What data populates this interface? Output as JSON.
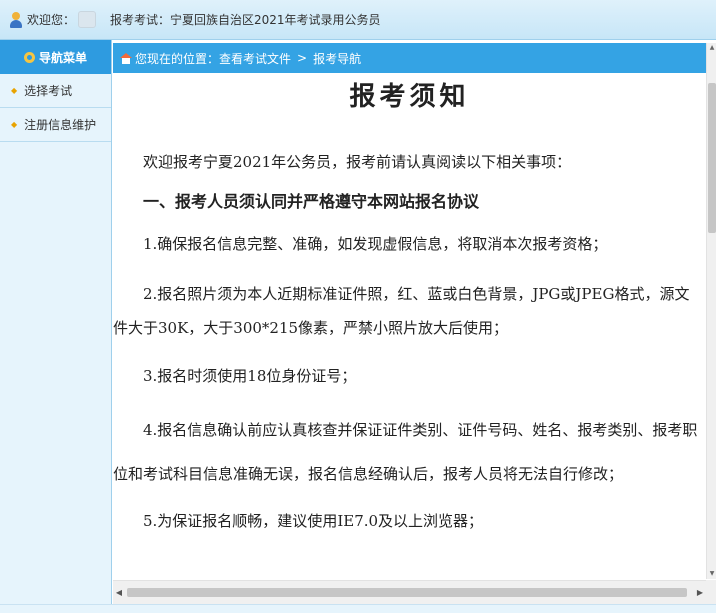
{
  "topbar": {
    "welcome": "欢迎您：",
    "exam_title": "报考考试：宁夏回族自治区2021年考试录用公务员"
  },
  "sidebar": {
    "header": "导航菜单",
    "items": [
      {
        "label": "选择考试"
      },
      {
        "label": "注册信息维护"
      }
    ]
  },
  "breadcrumb": {
    "prefix": "您现在的位置：查看考试文件",
    "separator": ">",
    "current": "报考导航"
  },
  "content": {
    "title": "报考须知",
    "intro": "欢迎报考宁夏2021年公务员，报考前请认真阅读以下相关事项：",
    "section1": "一、报考人员须认同并严格遵守本网站报名协议",
    "items": [
      "1.确保报名信息完整、准确，如发现虚假信息，将取消本次报考资格；",
      "2.报名照片须为本人近期标准证件照，红、蓝或白色背景，JPG或JPEG格式，源文件大于30K，大于300*215像素，严禁小照片放大后使用；",
      "3.报名时须使用18位身份证号；",
      "4.报名信息确认前应认真核查并保证证件类别、证件号码、姓名、报考类别、报考职位和考试科目信息准确无误，报名信息经确认后，报考人员将无法自行修改；",
      "5.为保证报名顺畅，建议使用IE7.0及以上浏览器；"
    ]
  },
  "icons": {
    "user": "user-icon",
    "nav": "nav-menu-icon",
    "home": "home-icon",
    "bullet": "arrow-bullet-icon"
  },
  "colors": {
    "nav_header": "#2e9be0",
    "breadcrumb": "#34a3e4",
    "sidebar_bg": "#e6f4fc",
    "bullet": "#e8a300"
  }
}
